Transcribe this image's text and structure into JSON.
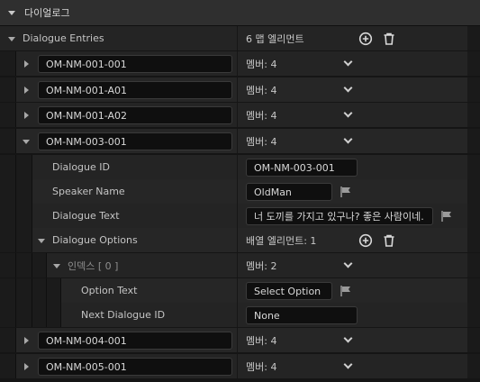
{
  "category": {
    "title": "다이얼로그"
  },
  "entries": {
    "label": "Dialogue Entries",
    "summary": "6 맵 엘리먼트"
  },
  "items": [
    {
      "key": "OM-NM-001-001",
      "value": "멤버: 4"
    },
    {
      "key": "OM-NM-001-A01",
      "value": "멤버: 4"
    },
    {
      "key": "OM-NM-001-A02",
      "value": "멤버: 4"
    },
    {
      "key": "OM-NM-003-001",
      "value": "멤버: 4"
    },
    {
      "key": "OM-NM-004-001",
      "value": "멤버: 4"
    },
    {
      "key": "OM-NM-005-001",
      "value": "멤버: 4"
    }
  ],
  "expanded": {
    "dialogue_id_label": "Dialogue ID",
    "dialogue_id_value": "OM-NM-003-001",
    "speaker_label": "Speaker Name",
    "speaker_value": "OldMan",
    "text_label": "Dialogue Text",
    "text_value": "너 도끼를 가지고 있구나? 좋은 사람이네.",
    "options_label": "Dialogue Options",
    "options_summary": "배열 엘리먼트: 1",
    "index_label": "인덱스 [ 0 ]",
    "index_value": "멤버: 2",
    "option_text_label": "Option Text",
    "option_text_value": "Select Option",
    "next_id_label": "Next Dialogue ID",
    "next_id_value": "None"
  }
}
